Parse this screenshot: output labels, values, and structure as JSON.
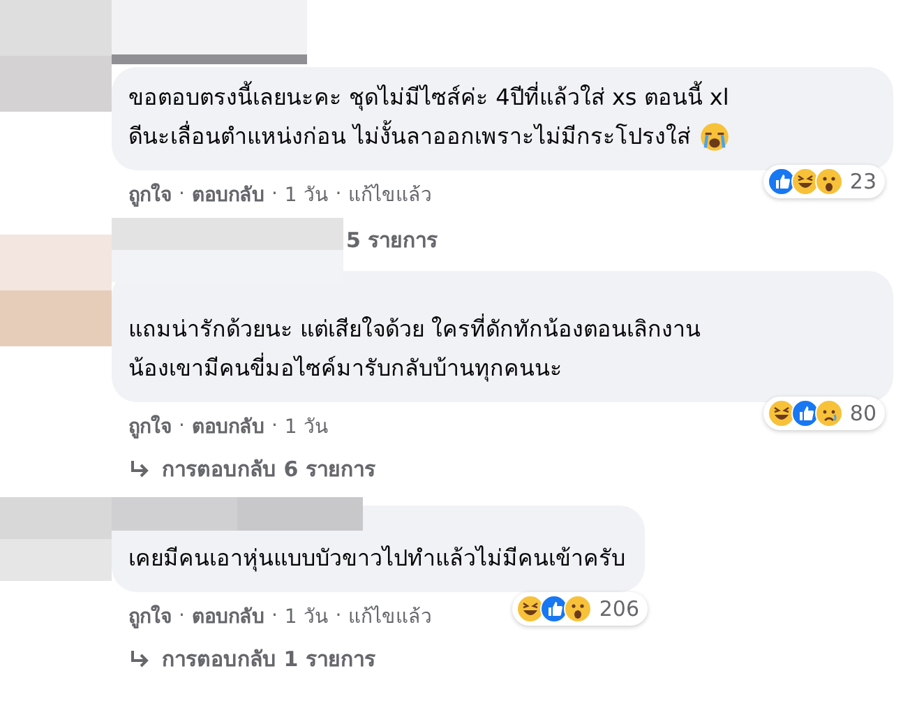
{
  "separator": "·",
  "comments": [
    {
      "text_lines": [
        "ขอตอบตรงนี้เลยนะคะ ชุดไม่มีไซส์ค่ะ 4ปีที่แล้วใส่ xs ตอนนี้ xl",
        "ดีนะเลื่อนตำแหน่งก่อน ไม่งั้นลาออกเพราะไม่มีกระโปรงใส่"
      ],
      "trailing_icon": {
        "kind": "cry"
      },
      "reactions": [
        {
          "kind": "like"
        },
        {
          "kind": "haha"
        },
        {
          "kind": "wow"
        }
      ],
      "count": "23",
      "actions": [
        {
          "kind": "link",
          "text": "ถูกใจ"
        },
        {
          "kind": "link",
          "text": "ตอบกลับ"
        },
        {
          "kind": "text",
          "text": "1 วัน"
        },
        {
          "kind": "text",
          "text": "แก้ไขแล้ว"
        }
      ],
      "reply_link": {
        "text": "5 รายการ",
        "arrow": false
      }
    },
    {
      "text_lines": [
        "แถมน่ารักด้วยนะ แต่เสียใจด้วย ใครที่ดักทักน้องตอนเลิกงาน",
        "น้องเขามีคนขี่มอไซค์มารับกลับบ้านทุกคนนะ"
      ],
      "reactions": [
        {
          "kind": "haha"
        },
        {
          "kind": "like"
        },
        {
          "kind": "sad"
        }
      ],
      "count": "80",
      "actions": [
        {
          "kind": "link",
          "text": "ถูกใจ"
        },
        {
          "kind": "link",
          "text": "ตอบกลับ"
        },
        {
          "kind": "text",
          "text": "1 วัน"
        }
      ],
      "reply_link": {
        "text": "การตอบกลับ 6 รายการ",
        "arrow": true
      }
    },
    {
      "text_lines": [
        "เคยมีคนเอาหุ่นแบบบัวขาวไปทำแล้วไม่มีคนเข้าครับ"
      ],
      "reactions": [
        {
          "kind": "haha"
        },
        {
          "kind": "like"
        },
        {
          "kind": "wow"
        }
      ],
      "count": "206",
      "actions": [
        {
          "kind": "link",
          "text": "ถูกใจ"
        },
        {
          "kind": "link",
          "text": "ตอบกลับ"
        },
        {
          "kind": "text",
          "text": "1 วัน"
        },
        {
          "kind": "text",
          "text": "แก้ไขแล้ว"
        }
      ],
      "reply_link": {
        "text": "การตอบกลับ 1 รายการ",
        "arrow": true
      }
    }
  ]
}
